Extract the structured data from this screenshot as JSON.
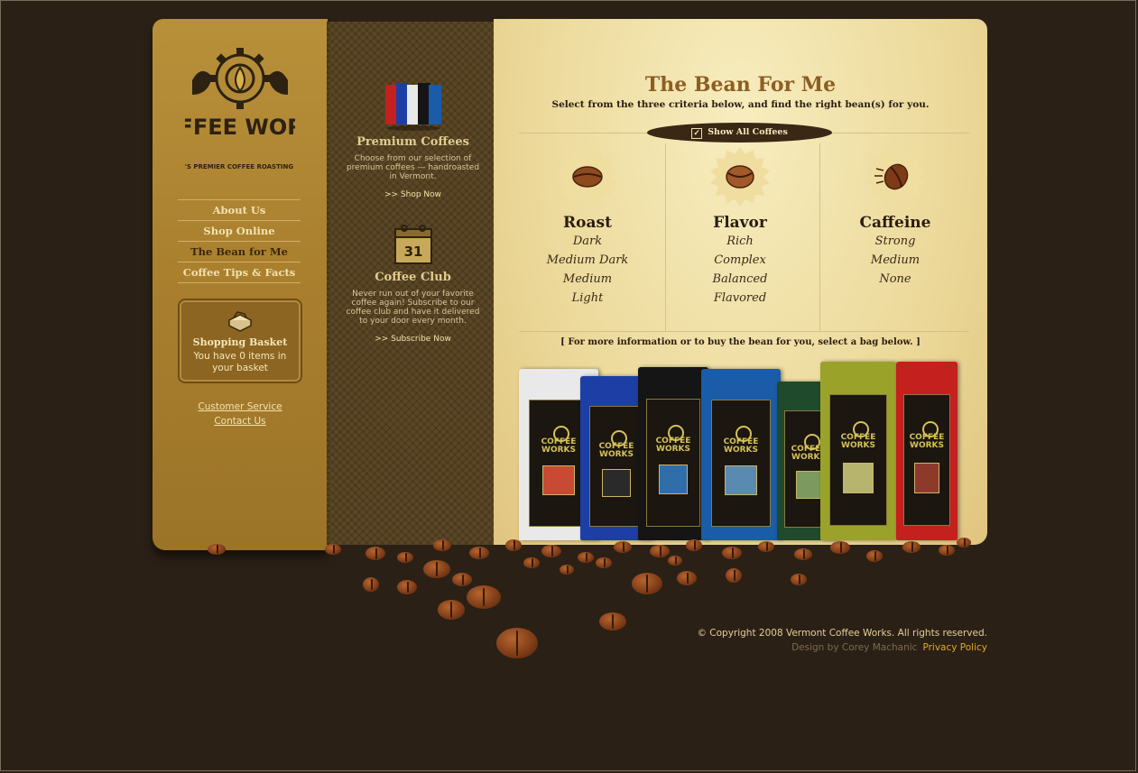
{
  "brand": {
    "name": "COFFEE WORKS",
    "tagline": "VERMONT'S PREMIER COFFEE ROASTING COMPANY"
  },
  "nav": {
    "items": [
      {
        "label": "About Us"
      },
      {
        "label": "Shop Online"
      },
      {
        "label": "The Bean for Me"
      },
      {
        "label": "Coffee Tips & Facts"
      }
    ]
  },
  "basket": {
    "title": "Shopping Basket",
    "text": "You have 0 items in your basket"
  },
  "left_links": {
    "customer_service": "Customer Service",
    "contact_us": "Contact Us"
  },
  "promos": {
    "premium": {
      "title": "Premium Coffees",
      "text": "Choose from our selection of premium coffees — handroasted in Vermont.",
      "link": ">> Shop Now"
    },
    "club": {
      "calendar_day": "31",
      "title": "Coffee Club",
      "text": "Never run out of your favorite coffee again! Subscribe to our coffee club and have it delivered to your door every month.",
      "link": ">> Subscribe Now"
    }
  },
  "main": {
    "title": "The Bean For Me",
    "subtitle": "Select from the three criteria below, and find the right bean(s) for you.",
    "show_all": "Show All Coffees",
    "criteria": [
      {
        "title": "Roast",
        "options": [
          "Dark",
          "Medium Dark",
          "Medium",
          "Light"
        ]
      },
      {
        "title": "Flavor",
        "options": [
          "Rich",
          "Complex",
          "Balanced",
          "Flavored"
        ]
      },
      {
        "title": "Caffeine",
        "options": [
          "Strong",
          "Medium",
          "None"
        ]
      }
    ],
    "info": "[ For more information or to buy the bean for you, select a bag below. ]",
    "bag_logo": "COFFEE WORKS",
    "bag_colors": [
      "#e9e9e9",
      "#1d3fa5",
      "#151515",
      "#1a5ca8",
      "#1f4a2c",
      "#9aa22a",
      "#c4201d"
    ]
  },
  "footer": {
    "copyright": "© Copyright 2008 Vermont Coffee Works. All rights reserved.",
    "design": "Design by Corey Machanic",
    "privacy": "Privacy Policy"
  }
}
